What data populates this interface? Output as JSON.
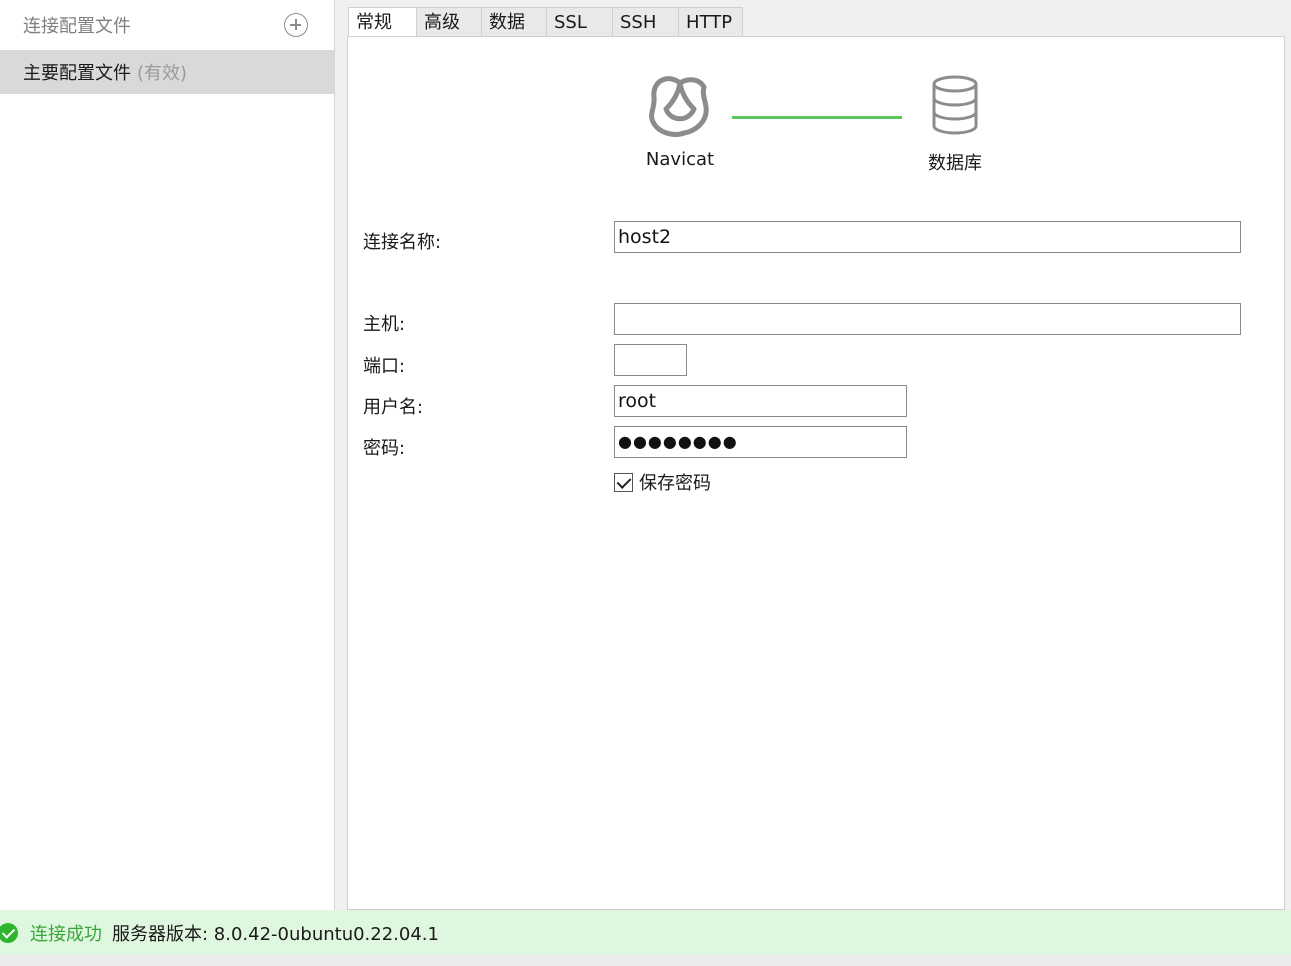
{
  "sidebar": {
    "header": "连接配置文件",
    "items": [
      {
        "label": "主要配置文件",
        "note": "(有效)"
      }
    ]
  },
  "tabs": [
    {
      "label": "常规",
      "active": true
    },
    {
      "label": "高级"
    },
    {
      "label": "数据库"
    },
    {
      "label": "SSL"
    },
    {
      "label": "SSH"
    },
    {
      "label": "HTTP"
    }
  ],
  "diagram": {
    "left_label": "Navicat",
    "right_label": "数据库",
    "link_color": "#5cc85c",
    "left_icon": "navicat-logo-icon",
    "right_icon": "database-icon"
  },
  "form": {
    "connection_name_label": "连接名称:",
    "connection_name_value": "host2",
    "host_label": "主机:",
    "host_value": "",
    "port_label": "端口:",
    "port_value": "",
    "username_label": "用户名:",
    "username_value": "root",
    "password_label": "密码:",
    "password_value": "●●●●●●●●",
    "save_password_label": "保存密码",
    "save_password_checked": true
  },
  "status": {
    "icon": "check-circle-icon",
    "ok_text": "连接成功",
    "info_text": "服务器版本: 8.0.42-0ubuntu0.22.04.1",
    "color": "#2db52d"
  }
}
